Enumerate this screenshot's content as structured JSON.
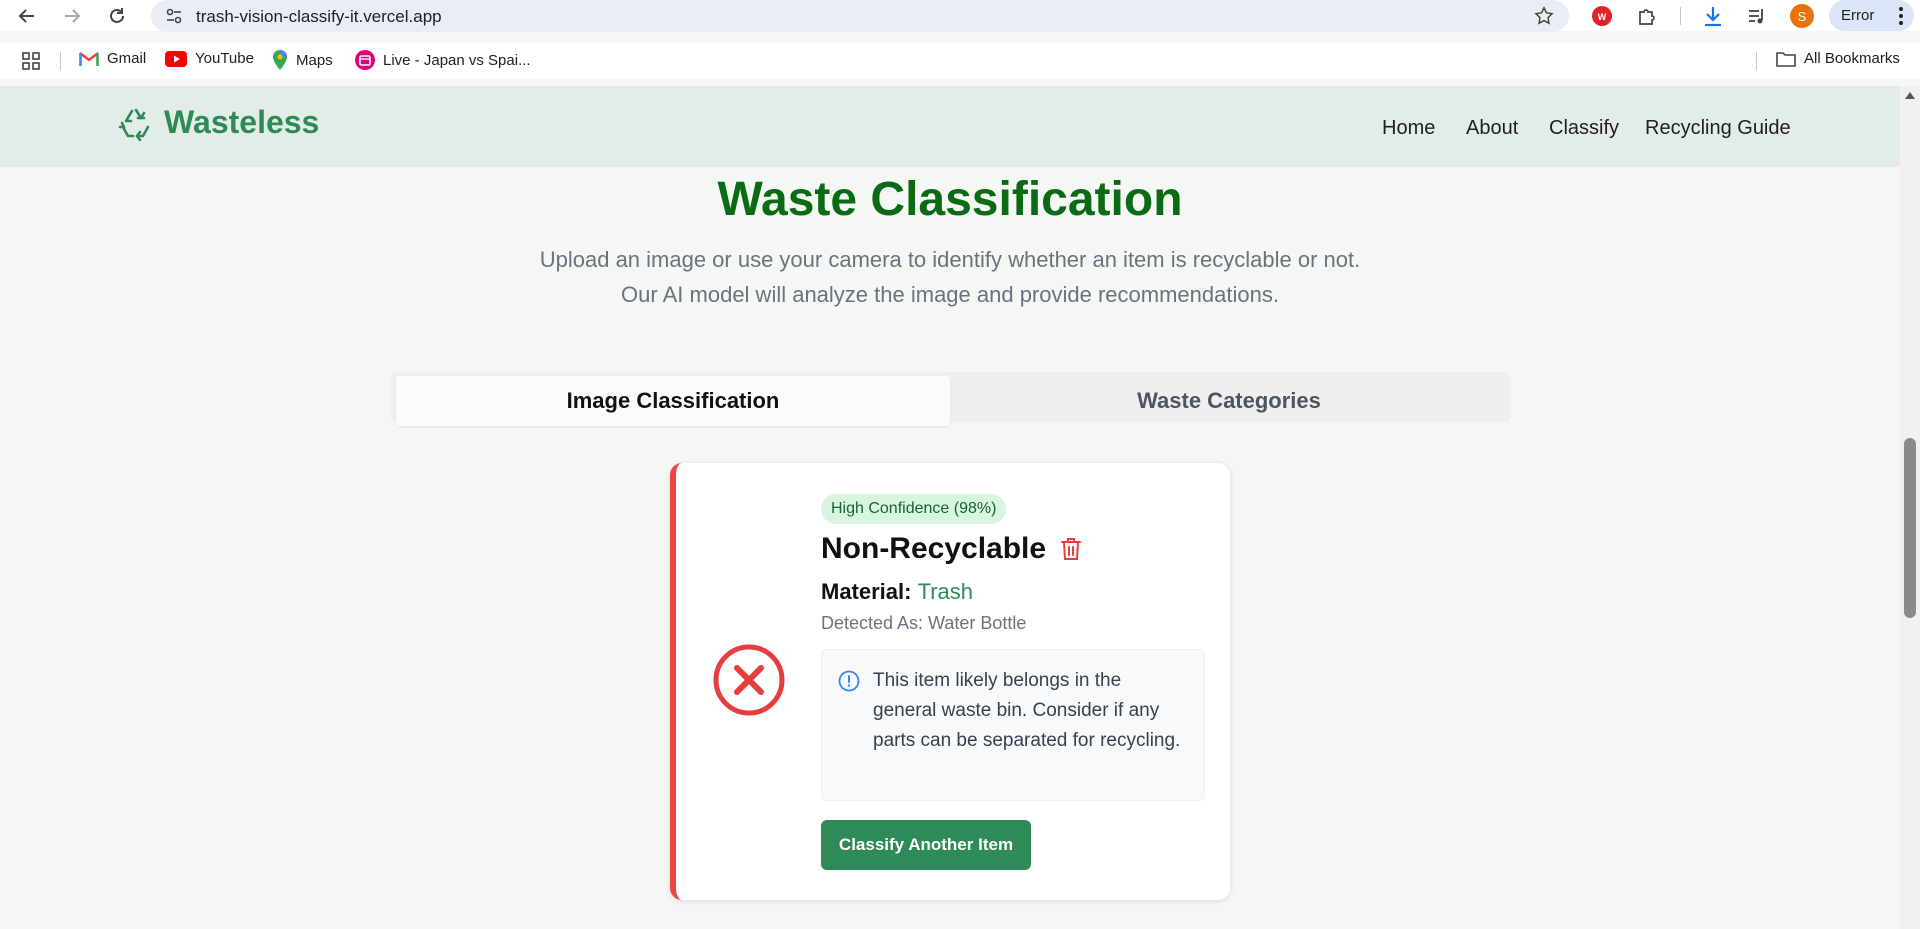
{
  "browser": {
    "url": "trash-vision-classify-it.vercel.app",
    "profile_initial": "S",
    "profile_label": "Error",
    "ext_badge": "W"
  },
  "bookmarks": [
    {
      "label": "Gmail"
    },
    {
      "label": "YouTube"
    },
    {
      "label": "Maps"
    },
    {
      "label": "Live - Japan vs Spai..."
    }
  ],
  "all_bookmarks_label": "All Bookmarks",
  "app": {
    "brand": "Wasteless",
    "nav": [
      "Home",
      "About",
      "Classify",
      "Recycling Guide"
    ]
  },
  "page": {
    "title": "Waste Classification",
    "subtitle_line1": "Upload an image or use your camera to identify whether an item is recyclable or not.",
    "subtitle_line2": "Our AI model will analyze the image and provide recommendations."
  },
  "tabs": [
    {
      "label": "Image Classification",
      "active": true
    },
    {
      "label": "Waste Categories",
      "active": false
    }
  ],
  "result": {
    "confidence": "High Confidence (98%)",
    "status": "Non-Recyclable",
    "material_label": "Material:",
    "material_value": "Trash",
    "detected": "Detected As: Water Bottle",
    "info": "This item likely belongs in the general waste bin. Consider if any parts can be separated for recycling.",
    "cta": "Classify Another Item"
  },
  "colors": {
    "brand_green": "#2e8b57",
    "title_green": "#0b6b14",
    "danger_red": "#e53e3e"
  }
}
